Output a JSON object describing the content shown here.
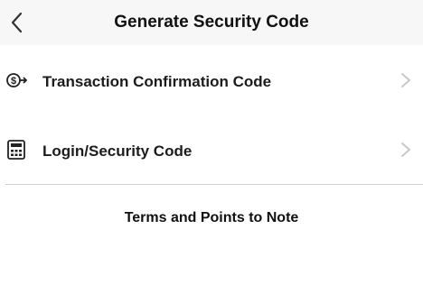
{
  "header": {
    "title": "Generate Security Code",
    "back_icon": "chevron-left-icon"
  },
  "list": {
    "items": [
      {
        "label": "Transaction Confirmation Code",
        "icon": "money-transfer-icon"
      },
      {
        "label": "Login/Security Code",
        "icon": "security-token-icon"
      }
    ]
  },
  "footer": {
    "link_label": "Terms and Points to Note"
  },
  "colors": {
    "header_background": "#f7f7f7",
    "divider": "#cfcfcf",
    "chevron": "#c7c7cc",
    "text": "#111111"
  }
}
